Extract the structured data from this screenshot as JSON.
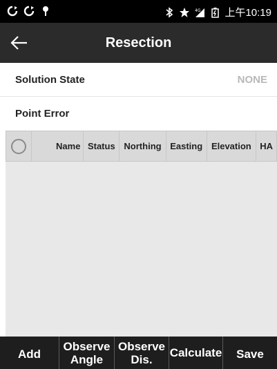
{
  "status_bar": {
    "icons_left": [
      "sync-icon",
      "sync-icon",
      "location-pin-icon"
    ],
    "icons_right": [
      "bluetooth-icon",
      "star-icon",
      "signal-4g-icon",
      "battery-icon"
    ],
    "time": "上午10:19"
  },
  "app_bar": {
    "back_icon": "arrow-left-icon",
    "title": "Resection"
  },
  "solution_state": {
    "label": "Solution State",
    "value": "NONE"
  },
  "point_error": {
    "label": "Point Error"
  },
  "table": {
    "columns": [
      "Name",
      "Status",
      "Northing",
      "Easting",
      "Elevation",
      "HA"
    ],
    "rows": []
  },
  "bottom_bar": {
    "add": "Add",
    "observe_angle": "Observe Angle",
    "observe_dis": "Observe Dis.",
    "calculate": "Calculate",
    "save": "Save"
  },
  "colors": {
    "status_bar": "#000000",
    "app_bar": "#2b2b2b",
    "bottom_bar": "#1e1e1e",
    "table_header": "#d9d9d9",
    "table_body": "#e8e8e8",
    "muted_value": "#b8b8b8"
  }
}
